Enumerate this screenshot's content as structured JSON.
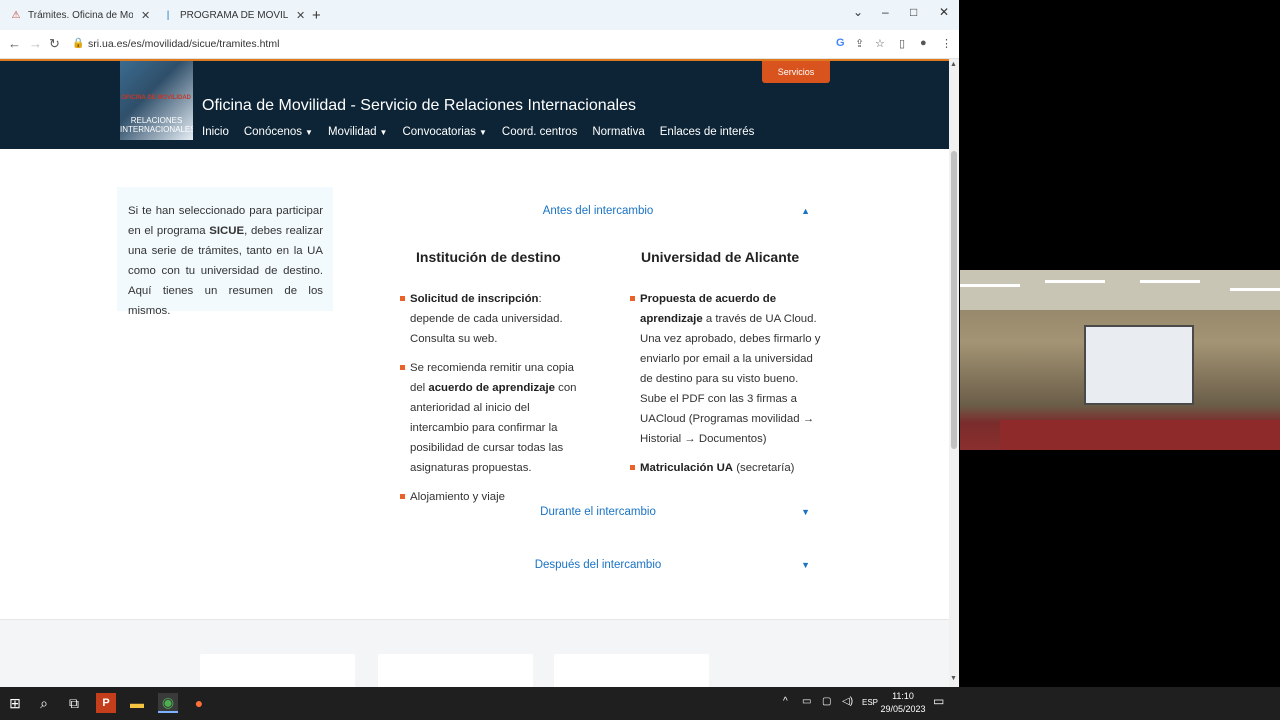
{
  "browser": {
    "tabs": [
      {
        "title": "Trámites. Oficina de Movilidad -",
        "active": true
      },
      {
        "title": "PROGRAMA DE MOVILIDAD SIC",
        "active": false
      }
    ],
    "new_tab": "+",
    "url": "sri.ua.es/es/movilidad/sicue/tramites.html",
    "controls": {
      "menu": "⌄",
      "minimize": "–",
      "maximize": "□",
      "close": "✕"
    }
  },
  "site": {
    "logo_top": "OFICINA DE MOVILIDAD",
    "logo_bottom": "RELACIONES INTERNACIONALES",
    "title": "Oficina de Movilidad - Servicio de Relaciones Internacionales",
    "services_button": "Servicios",
    "nav": [
      {
        "label": "Inicio",
        "caret": false
      },
      {
        "label": "Conócenos",
        "caret": true
      },
      {
        "label": "Movilidad",
        "caret": true
      },
      {
        "label": "Convocatorias",
        "caret": true
      },
      {
        "label": "Coord. centros",
        "caret": false
      },
      {
        "label": "Normativa",
        "caret": false
      },
      {
        "label": "Enlaces de interés",
        "caret": false
      }
    ],
    "intro": {
      "before": "Si te han seleccionado para participar en el programa ",
      "bold": "SICUE",
      "after": ", debes realizar una serie de trámites, tanto en la UA como con tu universidad de destino. Aquí tienes un resumen de los mismos."
    },
    "accordion": [
      {
        "label": "Antes del intercambio",
        "arrow": "▲",
        "expanded": true
      },
      {
        "label": "Durante el intercambio",
        "arrow": "▼",
        "expanded": false
      },
      {
        "label": "Después del intercambio",
        "arrow": "▼",
        "expanded": false
      }
    ],
    "columns": {
      "destino": {
        "title": "Institución de destino",
        "items": [
          {
            "bold_pre": "",
            "bold": "Solicitud de inscripción",
            "text": ": depende de cada universidad. Consulta su web."
          },
          {
            "bold_pre": "Se recomienda remitir una copia del ",
            "bold": "acuerdo de aprendizaje",
            "text": " con anterioridad al inicio del intercambio para confirmar la posibilidad de cursar todas las asignaturas propuestas."
          },
          {
            "bold_pre": "Alojamiento y viaje",
            "bold": "",
            "text": ""
          }
        ]
      },
      "alicante": {
        "title": "Universidad de Alicante",
        "items": [
          {
            "bold_pre": "",
            "bold": "Propuesta de acuerdo de aprendizaje",
            "text": " a través de UA Cloud. Una vez aprobado, debes firmarlo y enviarlo por email a la universidad de destino para su visto bueno. Sube el PDF con las 3 firmas a UACloud (Programas movilidad → Historial → Documentos)"
          },
          {
            "bold_pre": "",
            "bold": "Matriculación UA",
            "text": " (secretaría)"
          }
        ]
      }
    }
  },
  "taskbar": {
    "language": "ESP",
    "time": "11:10",
    "date": "29/05/2023"
  },
  "colors": {
    "header_bg": "#0d2436",
    "accent_orange": "#e8622a",
    "link_blue": "#1a73c4",
    "intro_bg": "#f2fafd"
  }
}
